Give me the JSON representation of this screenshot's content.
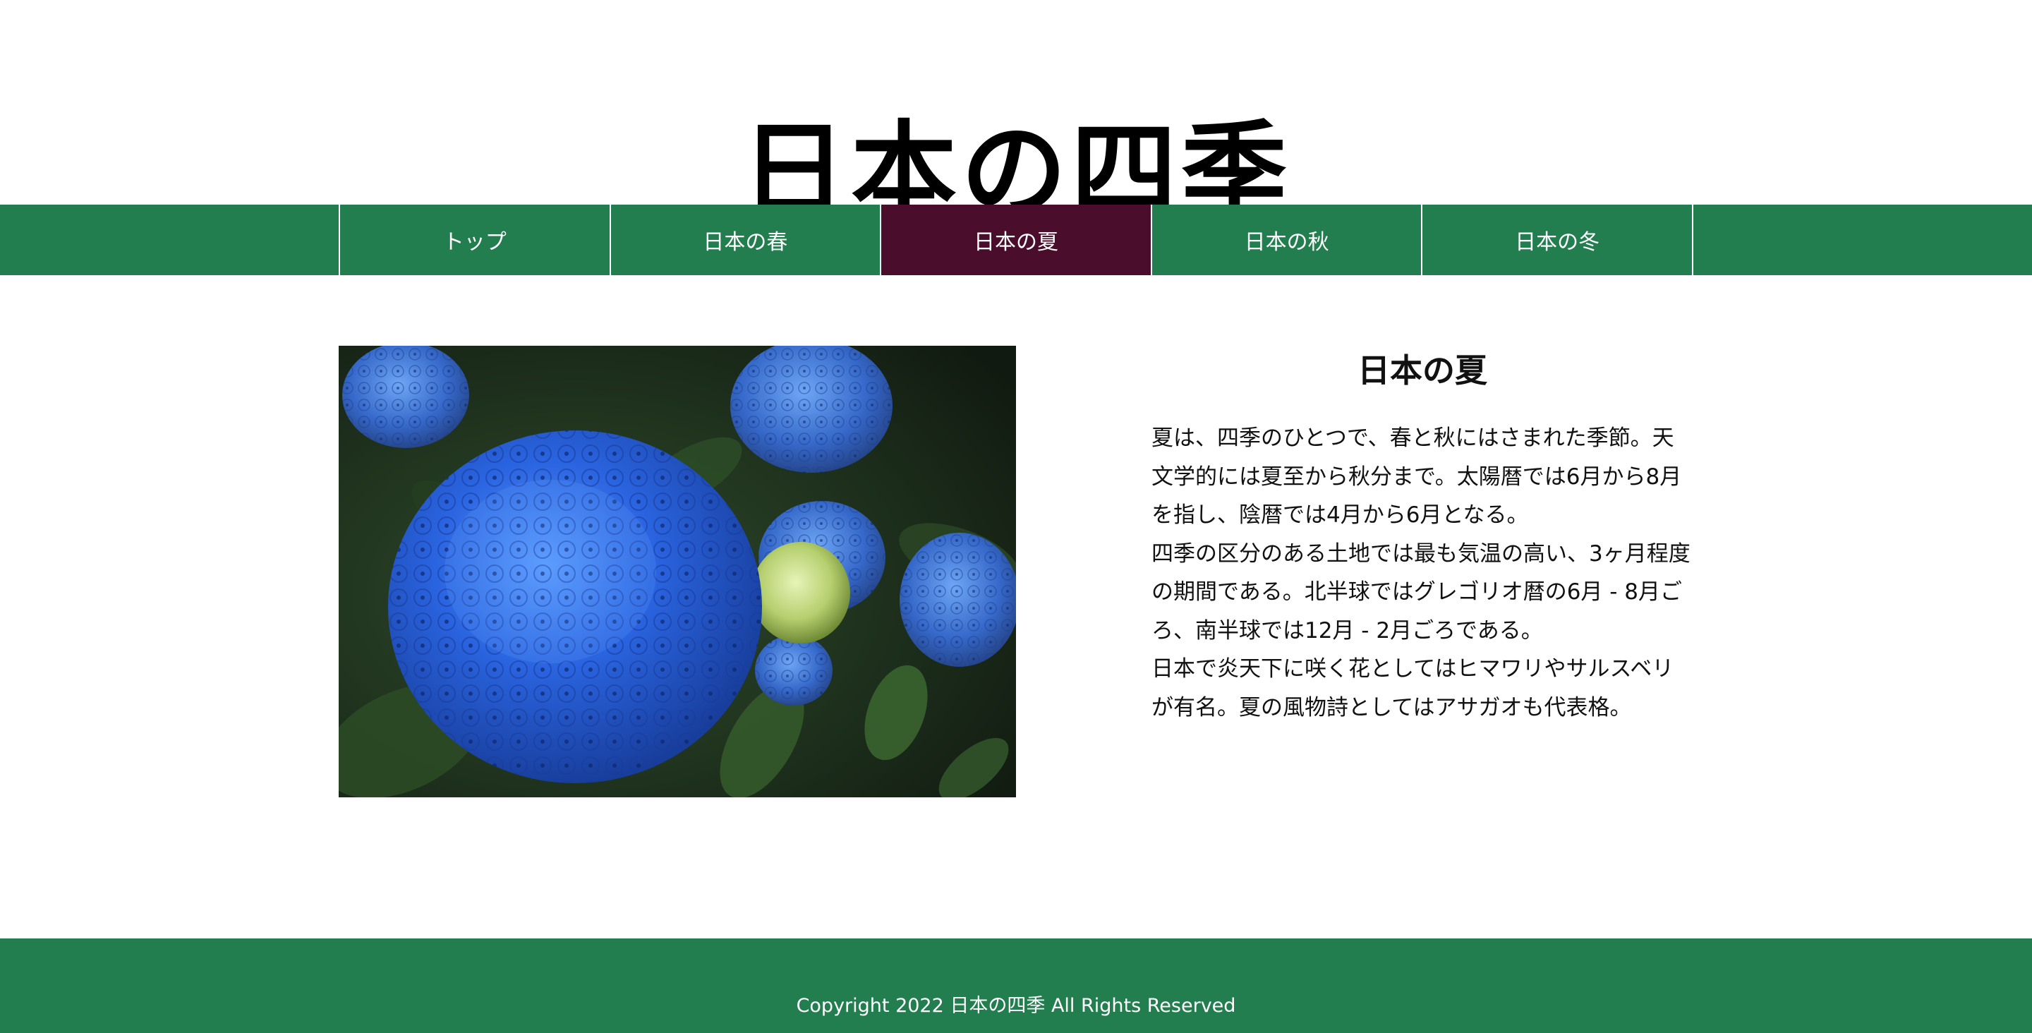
{
  "header": {
    "site_title": "日本の四季"
  },
  "nav": {
    "items": [
      {
        "label": "トップ",
        "active": false
      },
      {
        "label": "日本の春",
        "active": false
      },
      {
        "label": "日本の夏",
        "active": true
      },
      {
        "label": "日本の秋",
        "active": false
      },
      {
        "label": "日本の冬",
        "active": false
      }
    ]
  },
  "main": {
    "image": {
      "subject": "blue hydrangea flowers"
    },
    "article": {
      "title": "日本の夏",
      "paragraphs": [
        "夏は、四季のひとつで、春と秋にはさまれた季節。天文学的には夏至から秋分まで。太陽暦では6月から8月を指し、陰暦では4月から6月となる。",
        "四季の区分のある土地では最も気温の高い、3ヶ月程度の期間である。北半球ではグレゴリオ暦の6月 - 8月ごろ、南半球では12月 - 2月ごろである。",
        "日本で炎天下に咲く花としてはヒマワリやサルスベリが有名。夏の風物詩としてはアサガオも代表格。"
      ]
    }
  },
  "footer": {
    "copyright": "Copyright 2022 日本の四季 All Rights Reserved"
  },
  "colors": {
    "nav_bg": "#237e4f",
    "nav_active_bg": "#4a0d2b",
    "footer_bg": "#237e4f",
    "text": "#111111"
  }
}
